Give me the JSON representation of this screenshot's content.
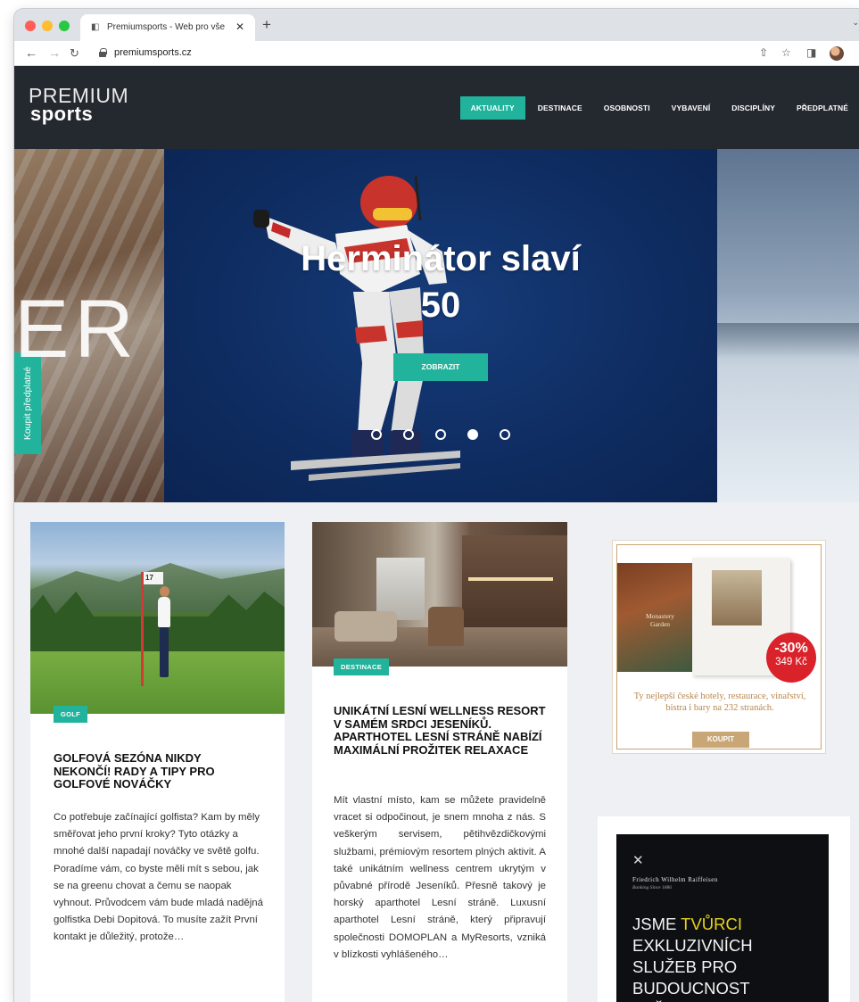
{
  "browser": {
    "tab_title": "Premiumsports - Web pro vše",
    "tab_close": "✕",
    "new_tab": "+",
    "url": "premiumsports.cz"
  },
  "site": {
    "logo_top": "PREMIUM",
    "logo_bottom": "sports",
    "nav": [
      "AKTUALITY",
      "DESTINACE",
      "OSOBNOSTI",
      "VYBAVENÍ",
      "DISCIPLÍNY",
      "PŘEDPLATNÉ"
    ],
    "nav_active_index": 0,
    "accent_color": "#22b39c",
    "header_color": "#24282f"
  },
  "hero": {
    "title_line1": "Herminátor slaví",
    "title_line2": "50",
    "button": "ZOBRAZIT",
    "left_letters": "ER",
    "slides_count": 5,
    "active_slide": 4
  },
  "side_tab": {
    "label": "Koupit předplatné"
  },
  "articles": [
    {
      "tag": "GOLF",
      "title": "GOLFOVÁ SEZÓNA NIKDY NEKONČÍ! RADY A TIPY PRO GOLFOVÉ NOVÁČKY",
      "excerpt": "Co potřebuje začínající golfista? Kam by měly směřovat jeho první kroky? Tyto otázky a mnohé další napadají nováčky ve světě golfu. Poradíme vám, co byste měli mít s sebou, jak se na greenu chovat a čemu se naopak vyhnout. Průvodcem vám bude mladá nadějná golfistka Debi Dopitová. To musíte zažít První kontakt je důležitý, protože…",
      "flag_number": "17"
    },
    {
      "tag": "DESTINACE",
      "title": "UNIKÁTNÍ LESNÍ WELLNESS RESORT V SAMÉM SRDCI JESENÍKŮ. APARTHOTEL LESNÍ STRÁNĚ NABÍZÍ MAXIMÁLNÍ PROŽITEK RELAXACE",
      "excerpt": "Mít vlastní místo, kam se můžete pravidelně vracet si odpočinout, je snem mnoha z nás. S veškerým servisem, pětihvězdičkovými službami, prémiovým resortem plných aktivit. A také unikátním wellness centrem ukrytým v půvabné přírodě Jeseníků. Přesně takový je horský aparthotel Lesní stráně. Luxusní aparthotel Lesní stráně, který připravují společnosti DOMOPLAN a MyResorts, vzniká v blízkosti vyhlášeného…"
    }
  ],
  "ad_book": {
    "page_title": "Monastery Garden",
    "discount": "-30%",
    "price": "349 Kč",
    "text": "Ty nejlepší české hotely, restaurace, vinařství, bistra i bary na 232 stranách.",
    "button": "KOUPIT"
  },
  "ad_bank": {
    "brand": "Friedrich Wilhelm Raiffeisen",
    "brand_sub": "Banking Since 1886",
    "headline_pre": "JSME ",
    "headline_highlight": "TVŮRCI",
    "headline_rest": "EXKLUZIVNÍCH SLUŽEB PRO BUDOUCNOST VAŠEHO MAJETKU",
    "highlight_color": "#e6d21d"
  }
}
